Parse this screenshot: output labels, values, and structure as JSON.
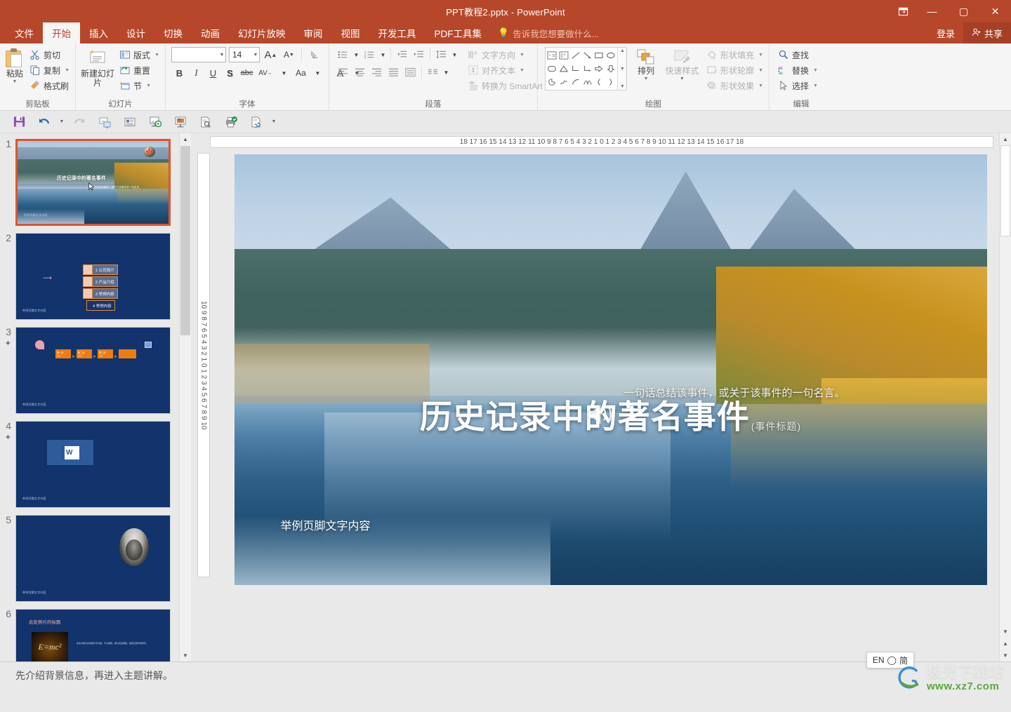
{
  "window": {
    "title": "PPT教程2.pptx - PowerPoint",
    "ribbon_display_icon": "ribbon-display-options-icon",
    "minimize": "—",
    "maximize": "▢",
    "close": "✕"
  },
  "tabs": [
    {
      "label": "文件",
      "active": false
    },
    {
      "label": "开始",
      "active": true
    },
    {
      "label": "插入",
      "active": false
    },
    {
      "label": "设计",
      "active": false
    },
    {
      "label": "切换",
      "active": false
    },
    {
      "label": "动画",
      "active": false
    },
    {
      "label": "幻灯片放映",
      "active": false
    },
    {
      "label": "审阅",
      "active": false
    },
    {
      "label": "视图",
      "active": false
    },
    {
      "label": "开发工具",
      "active": false
    },
    {
      "label": "PDF工具集",
      "active": false
    }
  ],
  "tellme": {
    "placeholder": "告诉我您想要做什么...",
    "icon": "lightbulb-icon"
  },
  "account": {
    "signin": "登录",
    "share": "共享"
  },
  "ribbon": {
    "groups": [
      {
        "name": "剪贴板",
        "paste": "粘贴",
        "items": [
          {
            "label": "剪切",
            "icon": "scissors-icon"
          },
          {
            "label": "复制",
            "icon": "copy-icon"
          },
          {
            "label": "格式刷",
            "icon": "format-painter-icon"
          }
        ]
      },
      {
        "name": "幻灯片",
        "new_slide": "新建幻灯片",
        "items": [
          {
            "label": "版式",
            "icon": "layout-icon"
          },
          {
            "label": "重置",
            "icon": "reset-icon"
          },
          {
            "label": "节",
            "icon": "section-icon"
          }
        ]
      },
      {
        "name": "字体",
        "font_name": "",
        "font_name_placeholder": "",
        "font_size": "14",
        "buttons": [
          "B",
          "I",
          "U",
          "S",
          "abc",
          "AV",
          "Aa",
          "A"
        ]
      },
      {
        "name": "段落",
        "items": [
          {
            "label": "文字方向",
            "icon": "text-direction-icon"
          },
          {
            "label": "对齐文本",
            "icon": "align-text-icon"
          },
          {
            "label": "转换为 SmartArt",
            "icon": "smartart-icon"
          }
        ]
      },
      {
        "name": "绘图",
        "arrange": "排列",
        "quick_styles": "快速样式",
        "items": [
          {
            "label": "形状填充",
            "icon": "shape-fill-icon"
          },
          {
            "label": "形状轮廓",
            "icon": "shape-outline-icon"
          },
          {
            "label": "形状效果",
            "icon": "shape-effects-icon"
          }
        ]
      },
      {
        "name": "编辑",
        "items": [
          {
            "label": "查找",
            "icon": "search-icon"
          },
          {
            "label": "替换",
            "icon": "replace-icon"
          },
          {
            "label": "选择",
            "icon": "select-cursor-icon"
          }
        ]
      }
    ]
  },
  "quick_toolbar": [
    {
      "name": "save-icon"
    },
    {
      "name": "undo-icon"
    },
    {
      "name": "redo-icon"
    },
    {
      "name": "start-presentation-icon"
    },
    {
      "name": "reading-view-icon"
    },
    {
      "name": "slideshow-from-beginning-icon"
    },
    {
      "name": "slideshow-current-icon"
    },
    {
      "name": "print-preview-icon"
    },
    {
      "name": "print-check-icon"
    },
    {
      "name": "hyperlink-page-icon"
    }
  ],
  "rulers": {
    "horizontal": "18  17  16  15  14  13  12  11  10  9  8  7  6  5  4  3  2  1  0  1  2  3  4  5  6  7  8  9  10  11  12  13  14  15  16  17  18",
    "vertical": "10  9  8  7  6  5  4  3  2  1  0  1  2  3  4  5  6  7  8  9  10"
  },
  "thumbnails": [
    {
      "number": "1",
      "animated": false,
      "selected": true,
      "footer": "举例页脚文字内容",
      "title": "历史记录中的著名事件",
      "subtitle": "一句话总结该事件，或关于该事件的一句名言。"
    },
    {
      "number": "2",
      "animated": false,
      "selected": false,
      "footer": "举例页脚文字内容",
      "items": [
        "1 公司简介",
        "2 产品介绍",
        "3 举例内容",
        "4 举例内容"
      ]
    },
    {
      "number": "3",
      "animated": true,
      "selected": false,
      "footer": "举例页脚文字内容",
      "boxes": [
        "第一步",
        "第二步",
        "第三步",
        ""
      ]
    },
    {
      "number": "4",
      "animated": true,
      "selected": false,
      "footer": "举例页脚文字内容",
      "word_letter": "W"
    },
    {
      "number": "5",
      "animated": false,
      "selected": false,
      "footer": "举例页脚文字内容"
    },
    {
      "number": "6",
      "animated": false,
      "selected": false,
      "title": "此处照片的标题",
      "formula": "E=mc²",
      "caption": "此处为照片的说明文字内容，可以编辑。照片来自网络，版权归原作者所有。"
    }
  ],
  "slide": {
    "title": "历史记录中的著名事件",
    "title_tag": "(事件标题)",
    "subtitle": "一句话总结该事件，或关于该事件的一句名言。",
    "footer": "举例页脚文字内容",
    "audio_icon": "speaker-audio-icon",
    "leaf_icon": "maple-leaf-icon",
    "column_icon": "ionic-column-icon"
  },
  "notes": {
    "text": "先介绍背景信息，再进入主题讲解。"
  },
  "ime": {
    "lang": "EN",
    "mode_icon": "pen-icon",
    "mode": "简"
  },
  "watermark": {
    "top": "极光下载站",
    "bottom": "www.xz7.com"
  },
  "colors": {
    "brand": "#b7472a",
    "ribbon_bg": "#f5f5f5",
    "app_bg": "#e9e9e9",
    "selection": "#e2532c",
    "slide_navy": "#12336b",
    "accent_orange": "#ee7d11"
  }
}
